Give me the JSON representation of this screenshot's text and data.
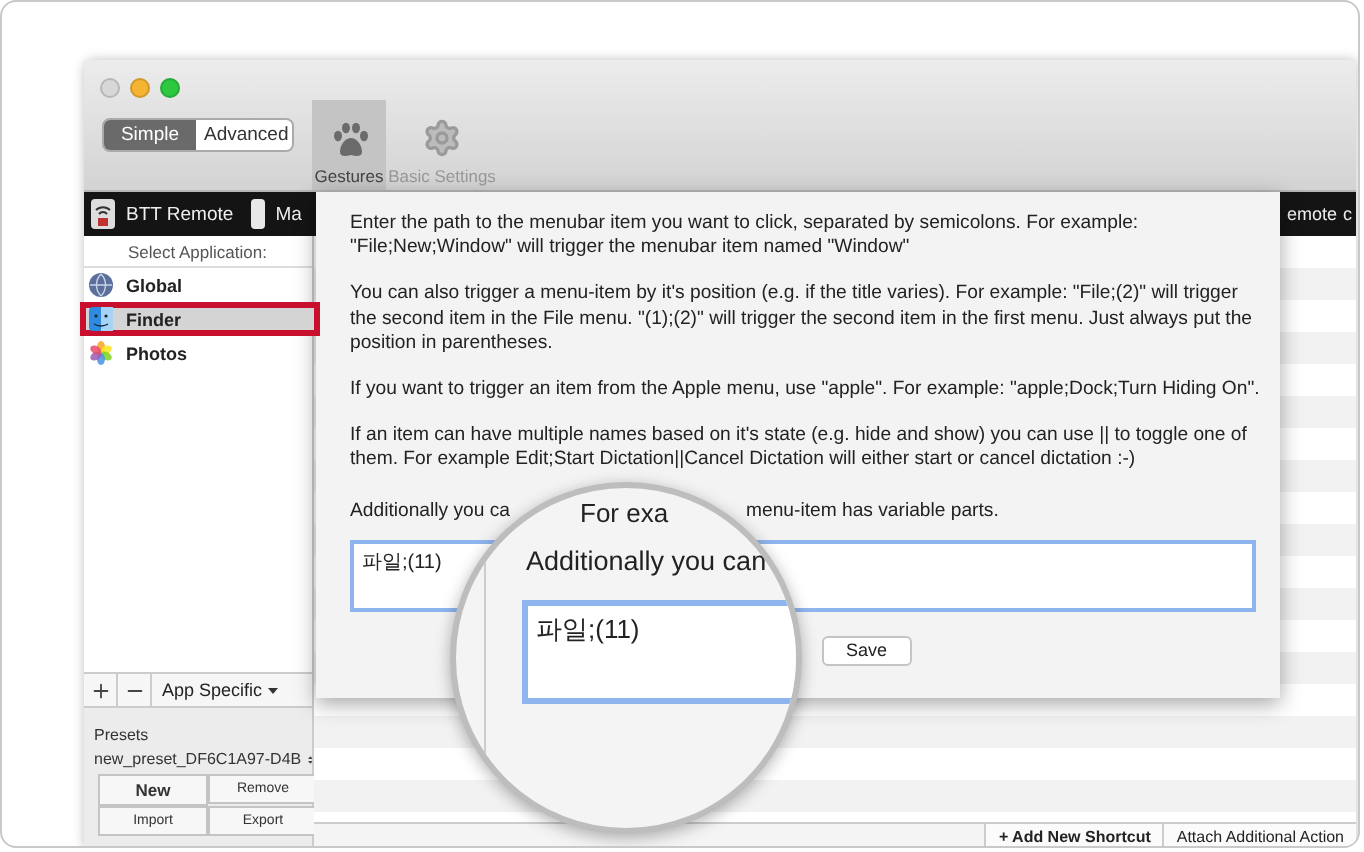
{
  "mode_switch": [
    {
      "label": "Simple",
      "selected": true
    },
    {
      "label": "Advanced",
      "selected": false
    }
  ],
  "toolbar": [
    {
      "label": "Gestures",
      "selected": true
    },
    {
      "label": "Basic Settings",
      "selected": false
    }
  ],
  "device_tabs_left": [
    {
      "label": "BTT Remote"
    },
    {
      "label": "Ma"
    }
  ],
  "device_tabs_right": [
    {
      "label": "emote"
    },
    {
      "label": "c"
    }
  ],
  "sidebar": {
    "heading": "Select Application:",
    "apps": [
      {
        "name": "Global",
        "selected": false,
        "highlighted": false
      },
      {
        "name": "Finder",
        "selected": true,
        "highlighted": true
      },
      {
        "name": "Photos",
        "selected": false,
        "highlighted": false
      }
    ],
    "scope": "App Specific",
    "presets_label": "Presets",
    "preset": "new_preset_DF6C1A97-D4B",
    "preset_buttons": [
      {
        "label": "New",
        "primary": true
      },
      {
        "label": "Remove",
        "primary": false
      },
      {
        "label": "Import",
        "primary": false
      },
      {
        "label": "Export",
        "primary": false
      }
    ]
  },
  "dialog": {
    "paragraphs": [
      "Enter the path to the menubar item you want to click, separated by semicolons. For example: \"File;New;Window\" will trigger the menubar item named \"Window\"",
      "You can also trigger a menu-item by it's position (e.g. if the title varies). For example: \"File;(2)\" will trigger the second item in the File menu. \"(1);(2)\" will trigger the second item in the first menu. Just always put the position in parentheses.",
      "If you want to trigger an item from the Apple menu, use \"apple\". For example: \"apple;Dock;Turn Hiding On\".",
      "If an item can have multiple names based on it's state (e.g. hide and show) you can use || to toggle one of them. For example Edit;Start Dictation||Cancel Dictation will either start or cancel dictation :-)"
    ],
    "partial_paragraph": [
      "Additionally you ca",
      "menu-item has variable parts."
    ],
    "field_value": "파일;(11)",
    "save": "Save"
  },
  "magnifier": {
    "fragment": "For exa",
    "label": "Additionally you can",
    "field_value": "파일;(11)"
  },
  "footer": [
    "+ Add New Shortcut",
    "Attach Additional Action"
  ]
}
